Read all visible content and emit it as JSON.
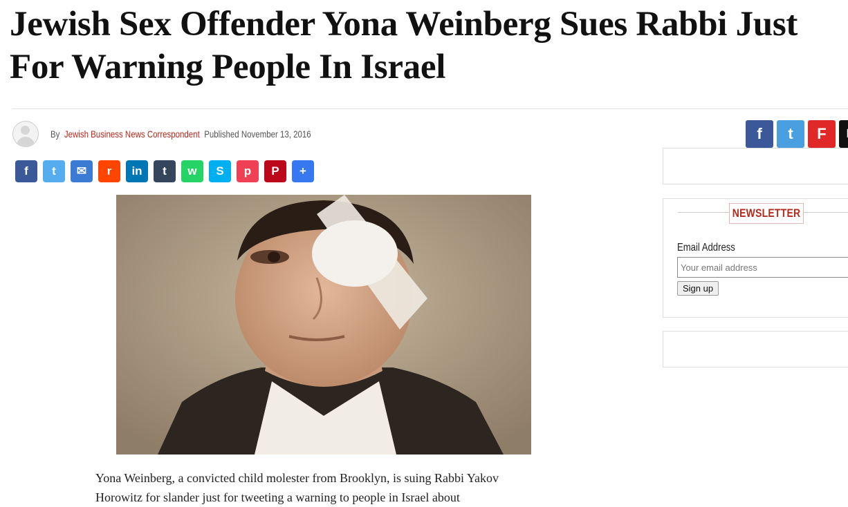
{
  "article": {
    "title_line1": "Jewish Sex Offender Yona Weinberg Sues Rabbi Just",
    "title_line2": "For Warning People In Israel",
    "byline_by": "By",
    "author": "Jewish Business News Correspondent",
    "published_label": "Published",
    "date": "November 13, 2016",
    "body_line1": "Yona Weinberg, a convicted child molester from Brooklyn, is suing Rabbi Yakov",
    "body_line2": "Horowitz for slander just for tweeting a warning to people in Israel about"
  },
  "share_top": [
    {
      "icon": "facebook-icon",
      "glyph": "f",
      "color": "#3b5998"
    },
    {
      "icon": "twitter-icon",
      "glyph": "t",
      "color": "#4a9fe0"
    },
    {
      "icon": "flipboard-icon",
      "glyph": "F",
      "color": "#e12828"
    },
    {
      "icon": "email-icon",
      "glyph": "✉",
      "color": "#111111"
    }
  ],
  "share_row": [
    {
      "icon": "facebook-icon",
      "glyph": "f",
      "color": "#3b5998"
    },
    {
      "icon": "twitter-icon",
      "glyph": "t",
      "color": "#55acee"
    },
    {
      "icon": "email-icon",
      "glyph": "✉",
      "color": "#3c7bd4"
    },
    {
      "icon": "reddit-icon",
      "glyph": "r",
      "color": "#ff4500"
    },
    {
      "icon": "linkedin-icon",
      "glyph": "in",
      "color": "#0077b5"
    },
    {
      "icon": "tumblr-icon",
      "glyph": "t",
      "color": "#35465c"
    },
    {
      "icon": "whatsapp-icon",
      "glyph": "w",
      "color": "#25d366"
    },
    {
      "icon": "skype-icon",
      "glyph": "S",
      "color": "#00aff0"
    },
    {
      "icon": "pocket-icon",
      "glyph": "p",
      "color": "#ef4056"
    },
    {
      "icon": "pinterest-icon",
      "glyph": "P",
      "color": "#bd081c"
    },
    {
      "icon": "add-share-icon",
      "glyph": "+",
      "color": "#3777f0"
    }
  ],
  "newsletter": {
    "title": "NEWSLETTER",
    "email_label": "Email Address",
    "email_placeholder": "Your email address",
    "signup_label": "Sign up"
  },
  "colors": {
    "accent": "#b5281c"
  }
}
